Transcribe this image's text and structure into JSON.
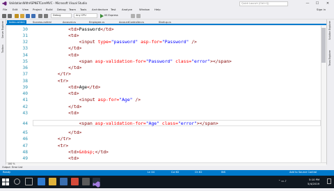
{
  "window": {
    "title": "ValidationWithASPNETCoreMVC - Microsoft Visual Studio",
    "quick_launch_placeholder": "Quick Launch (Ctrl+Q)",
    "controls": {
      "minimize": "—",
      "maximize": "☐",
      "close": "✕"
    }
  },
  "menu": {
    "items": [
      "File",
      "Edit",
      "View",
      "Project",
      "Build",
      "Debug",
      "Team",
      "Tools",
      "Architecture",
      "Test",
      "Analyze",
      "Window",
      "Help"
    ],
    "sign_in": "Sign in"
  },
  "toolbar": {
    "config_value": "Debug",
    "platform_value": "Any CPU",
    "run_target": "IIS Express"
  },
  "left_rail": [
    "Server Explorer",
    "Toolbox"
  ],
  "right_rail": [
    "Solution Explorer",
    "Team Explorer"
  ],
  "tabs": [
    {
      "label": "Index.cshtml",
      "active": true
    },
    {
      "label": "Success.cshtml",
      "active": false
    },
    {
      "label": "Account.cs",
      "active": false
    },
    {
      "label": "Employee.cs",
      "active": false
    },
    {
      "label": "AccountController.cs",
      "active": false
    },
    {
      "label": "Startup.cs",
      "active": false
    }
  ],
  "editor": {
    "line_numbers": [
      "30",
      "31",
      "32",
      "33",
      "34",
      "35",
      "36",
      "37",
      "38",
      "39",
      "40",
      "41",
      "42",
      "43",
      "44",
      "45",
      "46",
      "47",
      "48",
      "49"
    ],
    "code": {
      "l30_open": "<td>",
      "l30_text": "Password",
      "l30_close": "</td>",
      "l31": "<td>",
      "l32_open": "<input ",
      "l32_a1": "type=",
      "l32_v1": "\"password\"",
      "l32_a2": " asp-for=",
      "l32_v2": "\"Password\"",
      "l32_end": " />",
      "l33": "</td>",
      "l34": "<td>",
      "l35_open": "<span ",
      "l35_a1": "asp-validation-for=",
      "l35_v1": "\"Password\"",
      "l35_a2": " class=",
      "l35_v2": "\"error\"",
      "l35_end": "></span>",
      "l36": "</td>",
      "l37": "</tr>",
      "l38": "<tr>",
      "l39_open": "<td>",
      "l39_text": "Age",
      "l39_close": "</td>",
      "l40": "<td>",
      "l41_open": "<input ",
      "l41_a1": "asp-for=",
      "l41_v1": "\"Age\"",
      "l41_end": " />",
      "l42": "</td>",
      "l43": "<td>",
      "l44_open": "<span ",
      "l44_a1": "asp-validation-for=",
      "l44_v1": "\"Age\"",
      "l44_a2": " class=",
      "l44_v2": "\"error\"",
      "l44_end": "></span>",
      "l45": "</td>",
      "l46": "</tr>",
      "l47": "<tr>",
      "l48_open": "<td>",
      "l48_ent": "&nbsp;",
      "l48_close": "</td>",
      "l49": "<td>"
    },
    "zoom": "100 %"
  },
  "bottom_tabs": [
    "Output",
    "Error List"
  ],
  "status": {
    "left": "Ready",
    "ln": "Ln 44",
    "col": "Col 62",
    "ch": "Ch 62",
    "mode": "INS",
    "source_control": "Add to Source Control"
  },
  "taskbar": {
    "time": "5:10 PM",
    "date": "5/4/2019"
  },
  "colors": {
    "accent": "#007acc",
    "line_numbers": "#2b91af",
    "tag_name": "#800000",
    "attribute": "#ff0000",
    "attribute_value": "#0000ff"
  }
}
